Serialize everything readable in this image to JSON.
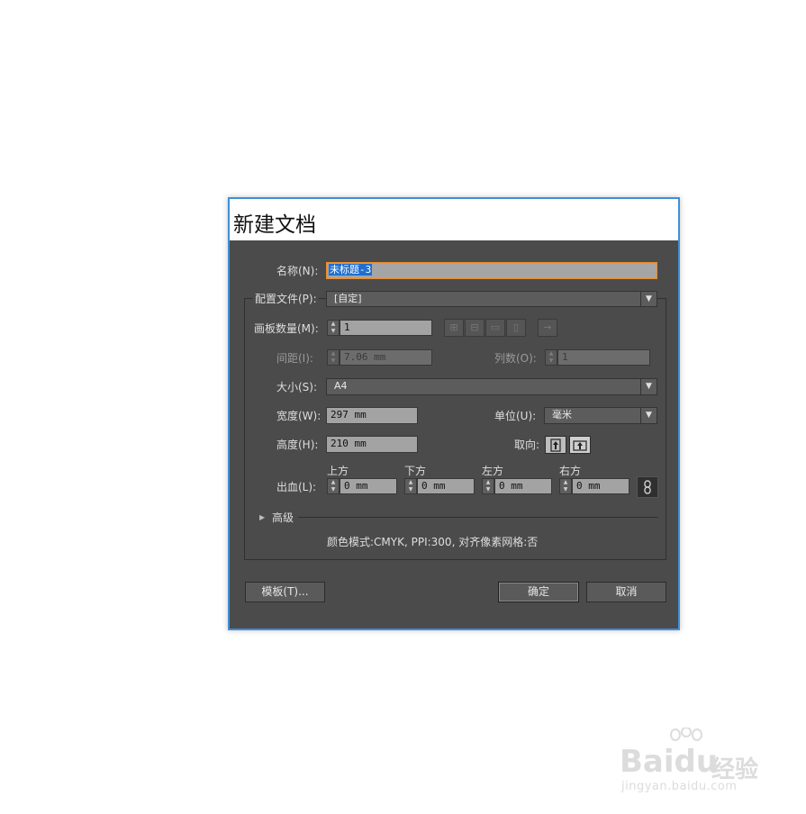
{
  "dialog": {
    "title": "新建文档",
    "name_label": "名称(N):",
    "name_value": "未标题-3",
    "profile_label": "配置文件(P):",
    "profile_value": "[自定]",
    "artboards_label": "画板数量(M):",
    "artboards_value": "1",
    "spacing_label": "间距(I):",
    "spacing_value": "7.06 mm",
    "columns_label": "列数(O):",
    "columns_value": "1",
    "size_label": "大小(S):",
    "size_value": "A4",
    "width_label": "宽度(W):",
    "width_value": "297 mm",
    "units_label": "单位(U):",
    "units_value": "毫米",
    "height_label": "高度(H):",
    "height_value": "210 mm",
    "orientation_label": "取向:",
    "bleed_label": "出血(L):",
    "bleed": [
      {
        "label": "上方",
        "value": "0 mm"
      },
      {
        "label": "下方",
        "value": "0 mm"
      },
      {
        "label": "左方",
        "value": "0 mm"
      },
      {
        "label": "右方",
        "value": "0 mm"
      }
    ],
    "advanced_label": "高级",
    "summary": "颜色模式:CMYK, PPI:300, 对齐像素网格:否",
    "templates_button": "模板(T)...",
    "ok_button": "确定",
    "cancel_button": "取消"
  },
  "watermark": {
    "brand": "Bai",
    "brand2": "du",
    "suffix": "经验",
    "url": "jingyan.baidu.com"
  },
  "colors": {
    "dialog_bg": "#4b4b4b",
    "accent_border": "#3f8fd8",
    "focus_border": "#f08a24"
  }
}
